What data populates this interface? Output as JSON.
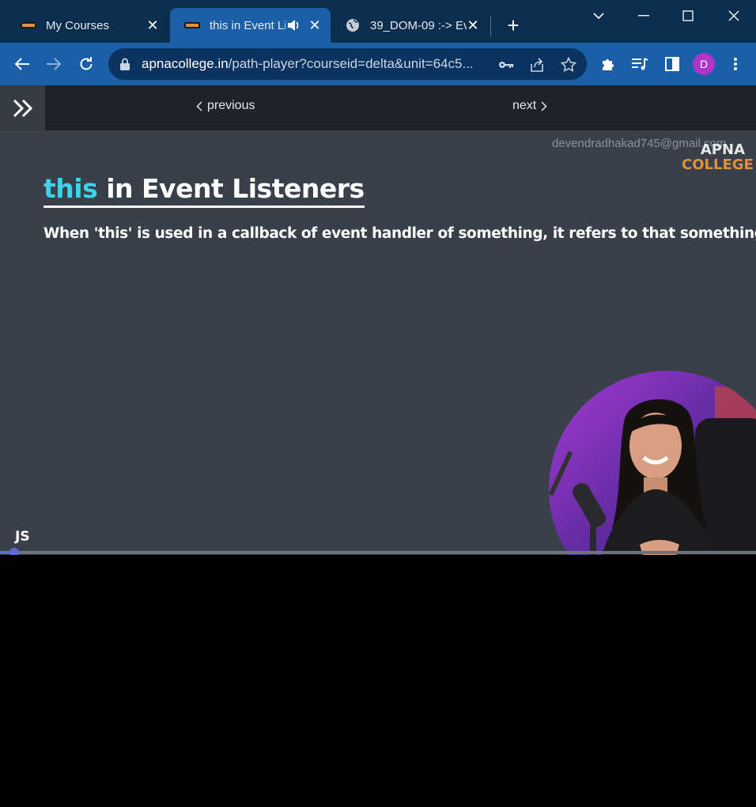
{
  "browser": {
    "tabs": [
      {
        "title": "My Courses",
        "active": false
      },
      {
        "title": "this in Event Li",
        "active": true,
        "audio": true
      },
      {
        "title": "39_DOM-09 :-> Ev",
        "active": false
      }
    ],
    "url_host": "apnacollege.in",
    "url_path": "/path-player?courseid=delta&unit=64c5...",
    "avatar_letter": "D",
    "colors": {
      "tabstrip": "#0b2d4e",
      "toolbar": "#1a5fa8",
      "avatar": "#b036c9"
    }
  },
  "pagenav": {
    "previous_label": "previous",
    "next_label": "next"
  },
  "video": {
    "watermark_email": "devendradhakad745@gmail.com",
    "brand_line1": "APNA",
    "brand_line2": "COLLEGE",
    "title_highlight": "this",
    "title_rest": " in Event Listeners",
    "body_text": "When 'this' is used in a callback of event handler of something, it refers to that something.",
    "course_tag": "JS",
    "progress_fraction": 0.019,
    "colors": {
      "highlight": "#3dd3ea",
      "slide_bg": "#394049",
      "brand_orange": "#e2913a",
      "progress": "#5b6bd8"
    }
  }
}
